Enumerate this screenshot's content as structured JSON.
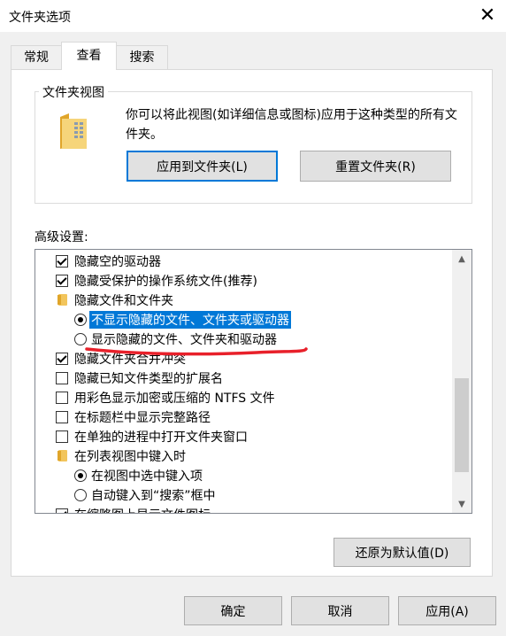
{
  "window": {
    "title": "文件夹选项",
    "close_glyph": "✕"
  },
  "tabs": [
    {
      "label": "常规"
    },
    {
      "label": "查看"
    },
    {
      "label": "搜索"
    }
  ],
  "folder_views": {
    "label": "文件夹视图",
    "description": "你可以将此视图(如详细信息或图标)应用于这种类型的所有文件夹。",
    "apply_button": "应用到文件夹(L)",
    "reset_button": "重置文件夹(R)"
  },
  "advanced": {
    "label": "高级设置:",
    "items": [
      {
        "type": "checkbox",
        "label": "隐藏空的驱动器",
        "checked": true
      },
      {
        "type": "checkbox",
        "label": "隐藏受保护的操作系统文件(推荐)",
        "checked": true
      },
      {
        "type": "folder",
        "label": "隐藏文件和文件夹"
      },
      {
        "type": "radio",
        "label": "不显示隐藏的文件、文件夹或驱动器",
        "selected": true
      },
      {
        "type": "radio",
        "label": "显示隐藏的文件、文件夹和驱动器",
        "selected": false
      },
      {
        "type": "checkbox",
        "label": "隐藏文件夹合并冲突",
        "checked": true
      },
      {
        "type": "checkbox",
        "label": "隐藏已知文件类型的扩展名",
        "checked": false
      },
      {
        "type": "checkbox",
        "label": "用彩色显示加密或压缩的 NTFS 文件",
        "checked": false
      },
      {
        "type": "checkbox",
        "label": "在标题栏中显示完整路径",
        "checked": false
      },
      {
        "type": "checkbox",
        "label": "在单独的进程中打开文件夹窗口",
        "checked": false
      },
      {
        "type": "folder",
        "label": "在列表视图中键入时"
      },
      {
        "type": "radio",
        "label": "在视图中选中键入项",
        "selected": true
      },
      {
        "type": "radio",
        "label": "自动键入到“搜索”框中",
        "selected": false
      },
      {
        "type": "checkbox",
        "label": "在缩略图上显示文件图标",
        "checked": true
      }
    ],
    "restore_button": "还原为默认值(D)"
  },
  "footer": {
    "ok": "确定",
    "cancel": "取消",
    "apply": "应用(A)"
  },
  "colors": {
    "accent": "#0078d7",
    "annotation": "#e8202a"
  }
}
